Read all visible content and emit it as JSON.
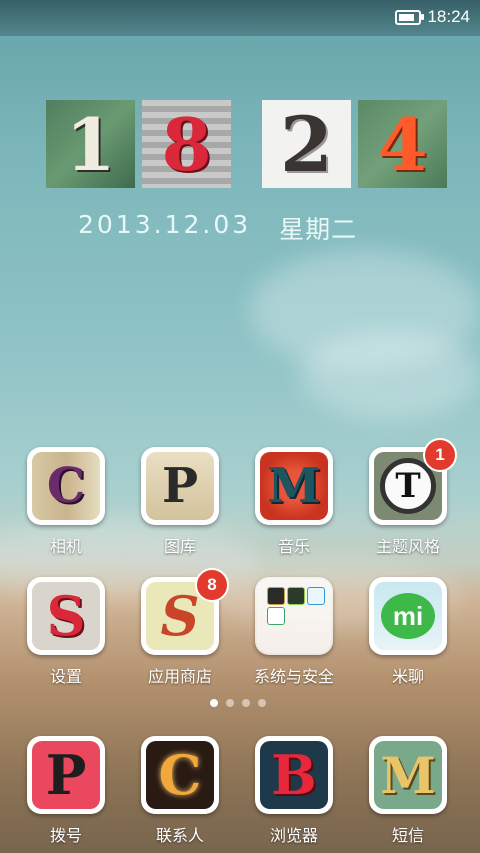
{
  "status": {
    "time": "18:24",
    "battery_level": 0.85
  },
  "clock": {
    "digits": [
      "1",
      "8",
      "2",
      "4"
    ]
  },
  "date": {
    "date": "2013.12.03",
    "weekday": "星期二"
  },
  "apps_row1": [
    {
      "label": "相机",
      "icon": "camera-c-icon",
      "letter": "C"
    },
    {
      "label": "图库",
      "icon": "gallery-p-icon",
      "letter": "P"
    },
    {
      "label": "音乐",
      "icon": "music-m-icon",
      "letter": "M"
    },
    {
      "label": "主题风格",
      "icon": "theme-t-icon",
      "letter": "T",
      "badge": "1"
    }
  ],
  "apps_row2": [
    {
      "label": "设置",
      "icon": "settings-s-icon",
      "letter": "S"
    },
    {
      "label": "应用商店",
      "icon": "app-store-s-icon",
      "letter": "S",
      "badge": "8"
    },
    {
      "label": "系统与安全",
      "icon": "folder-icon"
    },
    {
      "label": "米聊",
      "icon": "miliao-icon",
      "letter": "mi"
    }
  ],
  "page_indicator": {
    "count": 4,
    "active": 0
  },
  "dock": [
    {
      "label": "拨号",
      "icon": "dialer-p-icon",
      "letter": "P"
    },
    {
      "label": "联系人",
      "icon": "contacts-c-icon",
      "letter": "C"
    },
    {
      "label": "浏览器",
      "icon": "browser-b-icon",
      "letter": "B"
    },
    {
      "label": "短信",
      "icon": "messages-m-icon",
      "letter": "M"
    }
  ]
}
